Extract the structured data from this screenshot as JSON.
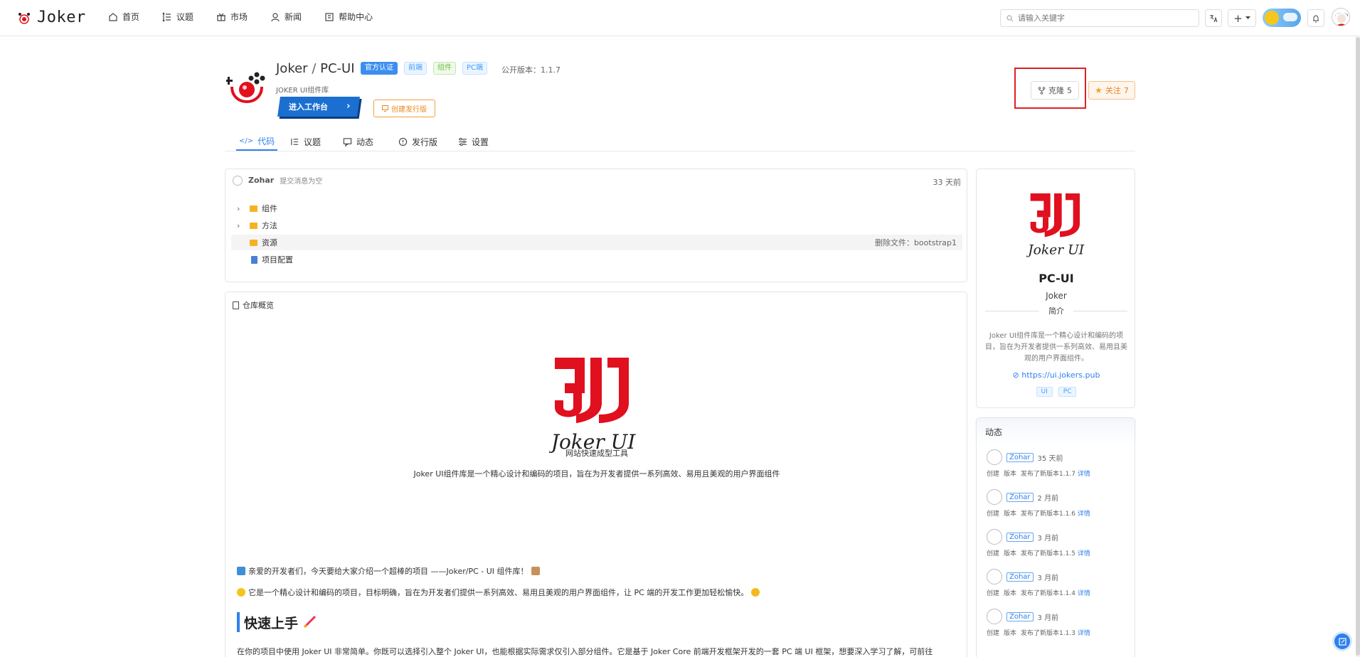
{
  "topnav": {
    "logo_text": "Joker",
    "items": [
      {
        "label": "首页",
        "icon": "home-icon"
      },
      {
        "label": "议题",
        "icon": "issues-icon"
      },
      {
        "label": "市场",
        "icon": "market-icon"
      },
      {
        "label": "新闻",
        "icon": "news-icon"
      },
      {
        "label": "帮助中心",
        "icon": "help-icon"
      }
    ],
    "search_placeholder": "请输入关键字",
    "add_label": "+"
  },
  "repo": {
    "owner": "Joker",
    "separator": "/",
    "name": "PC-UI",
    "badges": [
      "官方认证",
      "前端",
      "组件",
      "PC端"
    ],
    "version_label": "公开版本：",
    "version": "1.1.7",
    "subtitle": "JOKER UI组件库",
    "enter_label": "进入工作台",
    "release_label": "创建发行版",
    "clone_label": "克隆",
    "clone_count": "5",
    "follow_label": "关注",
    "follow_count": "7"
  },
  "tabs": [
    {
      "label": "代码",
      "icon": "code-icon",
      "active": true
    },
    {
      "label": "议题",
      "icon": "issues-icon"
    },
    {
      "label": "动态",
      "icon": "activity-icon"
    },
    {
      "label": "发行版",
      "icon": "release-icon"
    },
    {
      "label": "设置",
      "icon": "settings-icon"
    }
  ],
  "files": {
    "commit_user": "Zohar",
    "commit_msg": "提交消息为空",
    "commit_time": "33 天前",
    "rows": [
      {
        "name": "组件",
        "type": "folder",
        "expandable": true,
        "extra": ""
      },
      {
        "name": "方法",
        "type": "folder",
        "expandable": true,
        "extra": ""
      },
      {
        "name": "资源",
        "type": "folder",
        "expandable": false,
        "extra": "删除文件：bootstrap1"
      },
      {
        "name": "项目配置",
        "type": "file",
        "expandable": false,
        "extra": ""
      }
    ]
  },
  "readme": {
    "title": "仓库概览",
    "logo_text": "Joker UI",
    "tagline": "网站快速成型工具",
    "intro": "Joker UI组件库是一个精心设计和编码的项目，旨在为开发者提供一系列高效、易用且美观的用户界面组件",
    "para1": "亲爱的开发者们，今天要给大家介绍一个超棒的项目 ——Joker/PC - UI 组件库！",
    "para2": "它是一个精心设计和编码的项目，目标明确，旨在为开发者们提供一系列高效、易用且美观的用户界面组件，让 PC 端的开发工作更加轻松愉快。",
    "heading": "快速上手",
    "para3": "在你的项目中使用 Joker UI 非常简单。你既可以选择引入整个 Joker UI，也能根据实际需求仅引入部分组件。它是基于 Joker Core 前端开发框架开发的一套 PC 端 UI 框架，想要深入学习了解，可前往"
  },
  "sidebar": {
    "logo_text": "Joker UI",
    "name": "PC-UI",
    "owner": "Joker",
    "intro_label": "简介",
    "description": "Joker UI组件库是一个精心设计和编码的项目，旨在为开发者提供一系列高效、易用且美观的用户界面组件。",
    "link": "https://ui.jokers.pub",
    "tags": [
      "UI",
      "PC"
    ]
  },
  "activity": {
    "title": "动态",
    "items": [
      {
        "user": "Zohar",
        "time": "35 天前",
        "type": "创建",
        "kind": "版本",
        "text": "发布了新版本1.1.7",
        "detail": "详情"
      },
      {
        "user": "Zohar",
        "time": "2 月前",
        "type": "创建",
        "kind": "版本",
        "text": "发布了新版本1.1.6",
        "detail": "详情"
      },
      {
        "user": "Zohar",
        "time": "3 月前",
        "type": "创建",
        "kind": "版本",
        "text": "发布了新版本1.1.5",
        "detail": "详情"
      },
      {
        "user": "Zohar",
        "time": "3 月前",
        "type": "创建",
        "kind": "版本",
        "text": "发布了新版本1.1.4",
        "detail": "详情"
      },
      {
        "user": "Zohar",
        "time": "3 月前",
        "type": "创建",
        "kind": "版本",
        "text": "发布了新版本1.1.3",
        "detail": "详情"
      }
    ]
  },
  "colors": {
    "accent": "#2f80ed",
    "brand_red": "#e0101e",
    "highlight": "#e02020"
  }
}
